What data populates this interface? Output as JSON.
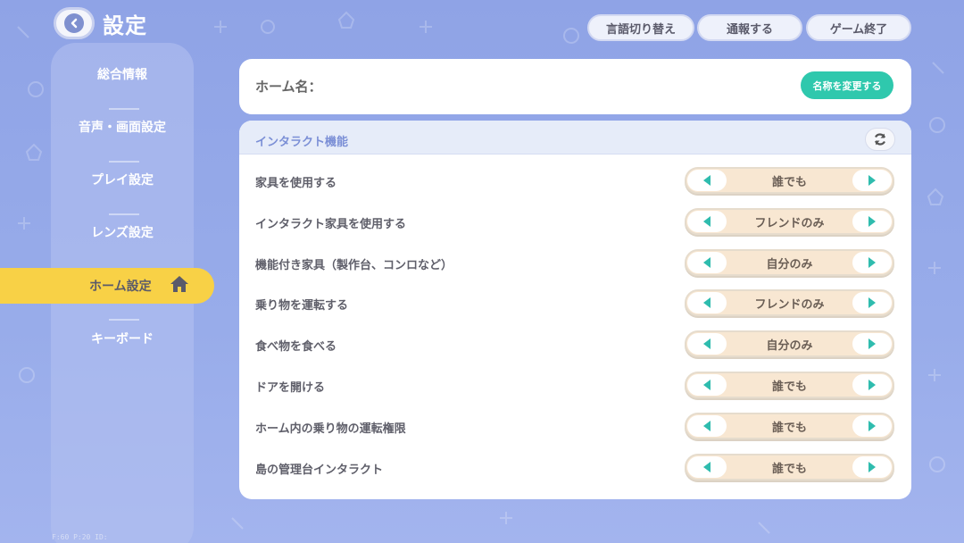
{
  "header": {
    "title": "設定",
    "buttons": [
      "言語切り替え",
      "通報する",
      "ゲーム終了"
    ]
  },
  "sidebar": {
    "items": [
      {
        "label": "総合情報"
      },
      {
        "label": "音声・画面設定"
      },
      {
        "label": "プレイ設定"
      },
      {
        "label": "レンズ設定"
      },
      {
        "label": "ホーム設定",
        "active": true
      },
      {
        "label": "キーボード"
      }
    ]
  },
  "home_name": {
    "label": "ホーム名：",
    "value": "",
    "rename_button": "名称を変更する"
  },
  "interact": {
    "section_title": "インタラクト機能",
    "rows": [
      {
        "label": "家具を使用する",
        "value": "誰でも"
      },
      {
        "label": "インタラクト家具を使用する",
        "value": "フレンドのみ"
      },
      {
        "label": "機能付き家具（製作台、コンロなど）",
        "value": "自分のみ"
      },
      {
        "label": "乗り物を運転する",
        "value": "フレンドのみ"
      },
      {
        "label": "食べ物を食べる",
        "value": "自分のみ"
      },
      {
        "label": "ドアを開ける",
        "value": "誰でも"
      },
      {
        "label": "ホーム内の乗り物の運転権限",
        "value": "誰でも"
      },
      {
        "label": "島の管理台インタラクト",
        "value": "誰でも"
      }
    ]
  },
  "footer": {
    "text": "F:60  P:20  ID:"
  },
  "colors": {
    "background": "#98acea",
    "active_tab": "#f8d146",
    "accent_teal": "#2fc8ad",
    "selector_fill": "#f8e7d2",
    "section_title": "#7b8fd6"
  },
  "icons": [
    "back-arrow-icon",
    "home-icon",
    "refresh-icon",
    "arrow-left-icon",
    "arrow-right-icon"
  ]
}
